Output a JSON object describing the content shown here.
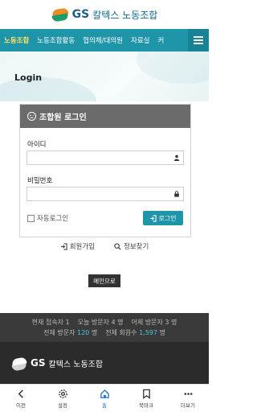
{
  "header": {
    "brand_gs": "GS",
    "brand_name": "칼텍스 노동조합"
  },
  "nav": {
    "items": [
      "노동조합",
      "노동조합활동",
      "협의체/대의원",
      "자료실",
      "커"
    ],
    "active_index": 0
  },
  "page": {
    "title": "Login"
  },
  "login": {
    "heading": "조합원 로그인",
    "id_label": "아이디",
    "id_value": "",
    "pw_label": "비밀번호",
    "pw_value": "",
    "remember_label": "자동로그인",
    "submit_label": "로그인"
  },
  "links": {
    "join": "회원가입",
    "find": "정보찾기"
  },
  "main_button": "메인으로",
  "stats": {
    "now_label": "현재 접속자",
    "now_value": "1",
    "today_label": "오늘 방문자",
    "today_value": "4",
    "yesterday_label": "어제 방문자",
    "yesterday_value": "3",
    "total_label": "전체 방문자",
    "total_value": "120",
    "members_label": "전체 회원수",
    "members_value": "1,597",
    "unit": "명"
  },
  "footer": {
    "brand_gs": "GS",
    "brand_name": "칼텍스 노동조합"
  },
  "bottom_tabs": [
    {
      "label": "이전",
      "icon": "back-icon"
    },
    {
      "label": "설정",
      "icon": "gear-icon"
    },
    {
      "label": "홈",
      "icon": "home-icon"
    },
    {
      "label": "북마크",
      "icon": "bookmark-icon"
    },
    {
      "label": "더보기",
      "icon": "more-icon"
    }
  ],
  "colors": {
    "accent": "#1e95a8",
    "active_nav": "#ffe066",
    "stat_number": "#4cc6d8",
    "active_tab": "#1e6fd0"
  }
}
